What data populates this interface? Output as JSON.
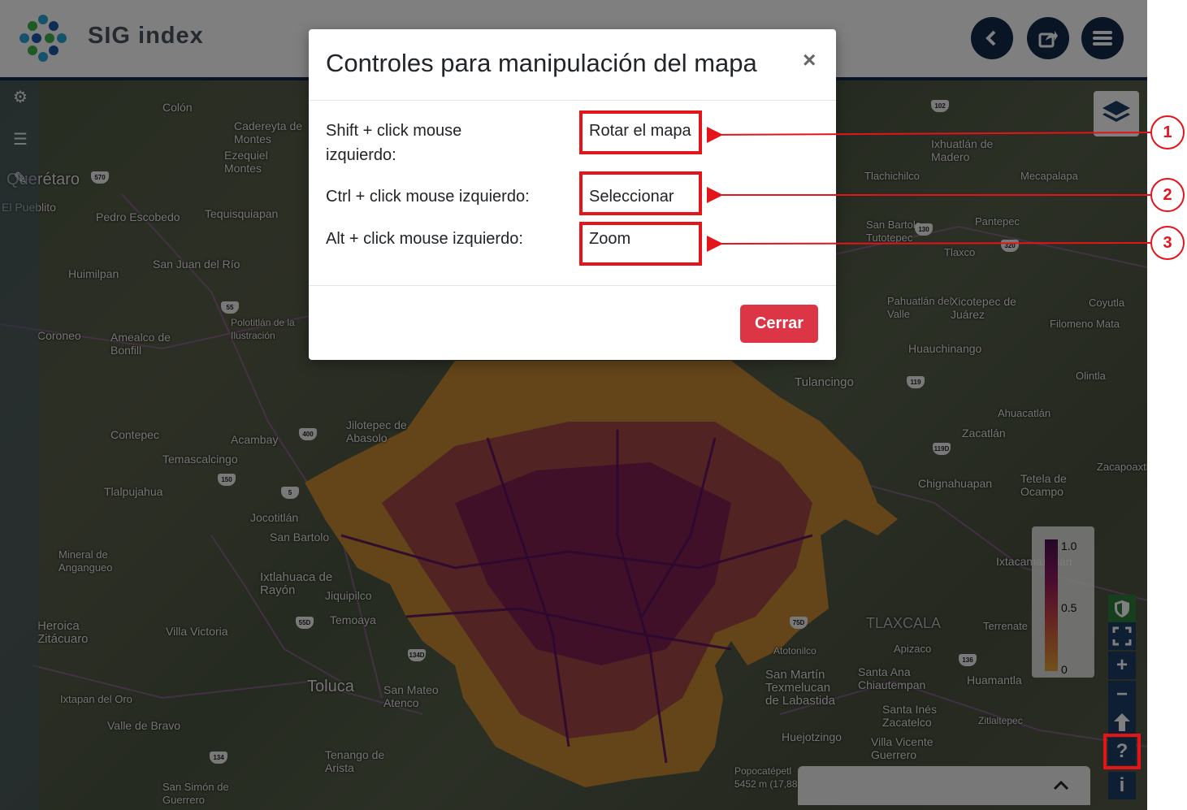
{
  "header": {
    "logo_text": "SIG index"
  },
  "map": {
    "places": [
      {
        "name": "Colón"
      },
      {
        "name": "Cadereyta de Montes"
      },
      {
        "name": "Ezequiel Montes"
      },
      {
        "name": "Querétaro"
      },
      {
        "name": "El Pueblito"
      },
      {
        "name": "Pedro Escobedo"
      },
      {
        "name": "Tequisquiapan"
      },
      {
        "name": "San Juan del Río"
      },
      {
        "name": "Huimilpan"
      },
      {
        "name": "Polotitlán de la Ilustración"
      },
      {
        "name": "Coroneo"
      },
      {
        "name": "Amealco de Bonfill"
      },
      {
        "name": "Contepec"
      },
      {
        "name": "Acambay"
      },
      {
        "name": "Jilotepec de Abasolo"
      },
      {
        "name": "Temascalcingo"
      },
      {
        "name": "Tlalpujahua"
      },
      {
        "name": "Jocotitlán"
      },
      {
        "name": "San Bartolo"
      },
      {
        "name": "Mineral de Angangueo"
      },
      {
        "name": "Ixtlahuaca de Rayón"
      },
      {
        "name": "Jiquipilco"
      },
      {
        "name": "Temoaya"
      },
      {
        "name": "Heroica Zitácuaro"
      },
      {
        "name": "Villa Victoria"
      },
      {
        "name": "Toluca"
      },
      {
        "name": "San Mateo Atenco"
      },
      {
        "name": "Ixtapan del Oro"
      },
      {
        "name": "Valle de Bravo"
      },
      {
        "name": "Tenango de Arista"
      },
      {
        "name": "San Simón de Guerrero"
      },
      {
        "name": "Ixhuatlán de Madero"
      },
      {
        "name": "Tlachichilco"
      },
      {
        "name": "Mecapalapa"
      },
      {
        "name": "San Bartolo Tutotepec"
      },
      {
        "name": "Pantepec"
      },
      {
        "name": "Tlaxco"
      },
      {
        "name": "Pahuatlán del Valle"
      },
      {
        "name": "Xicotepec de Juárez"
      },
      {
        "name": "Coyutla"
      },
      {
        "name": "Filomeno Mata"
      },
      {
        "name": "Huauchinango"
      },
      {
        "name": "Olintla"
      },
      {
        "name": "Tulancingo"
      },
      {
        "name": "Zacatlán"
      },
      {
        "name": "Ahuacatlán"
      },
      {
        "name": "Chignahuapan"
      },
      {
        "name": "Tetela de Ocampo"
      },
      {
        "name": "Zacapoaxtla"
      },
      {
        "name": "Ixtacamaxtitlán"
      },
      {
        "name": "TLAXCALA"
      },
      {
        "name": "Apizaco"
      },
      {
        "name": "Terrenate"
      },
      {
        "name": "Atotonilco"
      },
      {
        "name": "San Martín Texmelucan de Labastida"
      },
      {
        "name": "Santa Ana Chiautempan"
      },
      {
        "name": "Huamantla"
      },
      {
        "name": "Santa Inés Zacatelco"
      },
      {
        "name": "Zitlaltepec"
      },
      {
        "name": "Huejotzingo"
      },
      {
        "name": "Villa Vicente Guerrero"
      },
      {
        "name": "Popocatépetl 5452 m (17,88"
      }
    ],
    "shields": [
      "102",
      "570",
      "55",
      "5",
      "400",
      "150",
      "119",
      "119D",
      "320",
      "130",
      "134D",
      "55D",
      "75D",
      "136",
      "134"
    ]
  },
  "legend": {
    "max": "1.0",
    "mid": "0.5",
    "min": "0"
  },
  "modal": {
    "title": "Controles para manipulación del mapa",
    "close_symbol": "×",
    "rows": [
      {
        "key_line1": "Shift + click mouse",
        "key_line2": "izquierdo:",
        "action": "Rotar el mapa"
      },
      {
        "key_line1": "Ctrl + click mouse izquierdo:",
        "key_line2": "",
        "action": "Seleccionar"
      },
      {
        "key_line1": "Alt + click mouse izquierdo:",
        "key_line2": "",
        "action": "Zoom"
      }
    ],
    "close_button": "Cerrar"
  },
  "callouts": [
    "1",
    "2",
    "3"
  ],
  "colors": {
    "brand": "#13294b",
    "danger": "#dc3545",
    "annotation": "#e4141b",
    "control": "#1d3c67"
  }
}
